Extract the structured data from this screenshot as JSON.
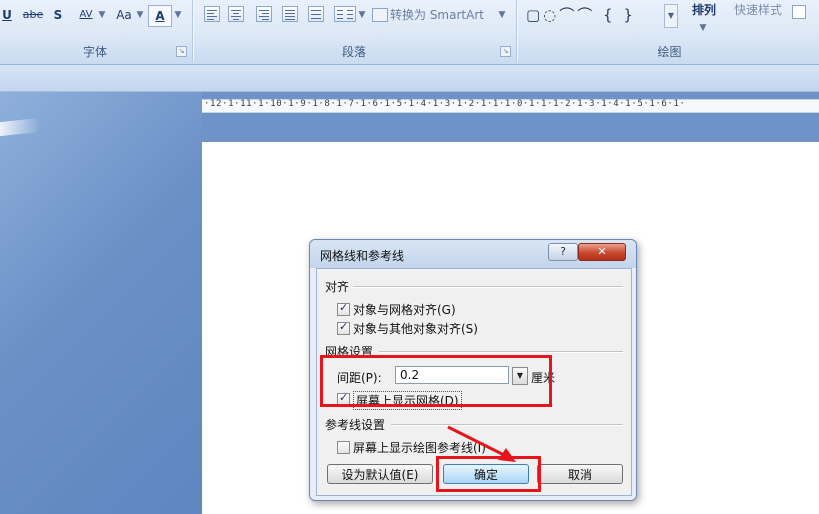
{
  "ribbon": {
    "font_group_label": "字体",
    "paragraph_group_label": "段落",
    "drawing_group_label": "绘图",
    "font_buttons": [
      "U",
      "abe",
      "S",
      "AV",
      "Aa",
      "A"
    ],
    "smartart_label": "转换为 SmartArt",
    "arrange_label": "排列",
    "quick_styles_label": "快速样式",
    "shapes_glyphs": "▢◌⌒⌒ { }"
  },
  "ruler": {
    "text": "·12·1·11·1·10·1·9·1·8·1·7·1·6·1·5·1·4·1·3·1·2·1·1·1·0·1·1·1·2·1·3·1·4·1·5·1·6·1·"
  },
  "dialog": {
    "title": "网格线和参考线",
    "help_label": "?",
    "close_label": "✕",
    "align_section": "对齐",
    "snap_grid_label": "对象与网格对齐(G)",
    "snap_grid_checked": true,
    "snap_objects_label": "对象与其他对象对齐(S)",
    "snap_objects_checked": true,
    "grid_section": "网格设置",
    "spacing_label": "间距(P):",
    "spacing_value": "0.2",
    "spacing_unit": "厘米",
    "show_grid_label": "屏幕上显示网格(D)",
    "show_grid_checked": true,
    "guides_section": "参考线设置",
    "show_guides_label": "屏幕上显示绘图参考线(I)",
    "show_guides_checked": false,
    "default_button": "设为默认值(E)",
    "ok_button": "确定",
    "cancel_button": "取消"
  },
  "colors": {
    "highlight": "#e8141b",
    "desktop": "#6f93c6"
  }
}
